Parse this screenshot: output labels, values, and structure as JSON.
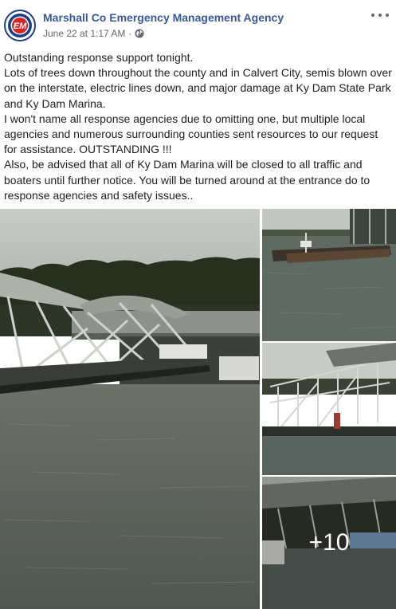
{
  "post": {
    "page_name": "Marshall Co Emergency Management Agency",
    "timestamp": "June 22 at 1:17 AM",
    "separator": "·",
    "privacy_icon": "globe-icon",
    "more_icon": "more-options-icon",
    "avatar_text": "EM",
    "paragraphs": [
      "Outstanding response support tonight.",
      "Lots of trees down throughout the county and in Calvert City, semis blown over on the interstate, electric lines down, and major damage at Ky Dam State Park and Ky Dam Marina.",
      "I won't name all response agencies due to omitting one, but multiple local agencies and numerous surrounding counties sent resources to our request for assistance. OUTSTANDING !!!",
      "Also, be advised that all of Ky Dam Marina will be closed to all traffic and boaters until further notice. You will be turned around at the entrance do to response agencies and safety issues.."
    ],
    "more_photos_label": "+10"
  },
  "colors": {
    "link": "#385898",
    "meta": "#616770",
    "text": "#1c1e21"
  }
}
